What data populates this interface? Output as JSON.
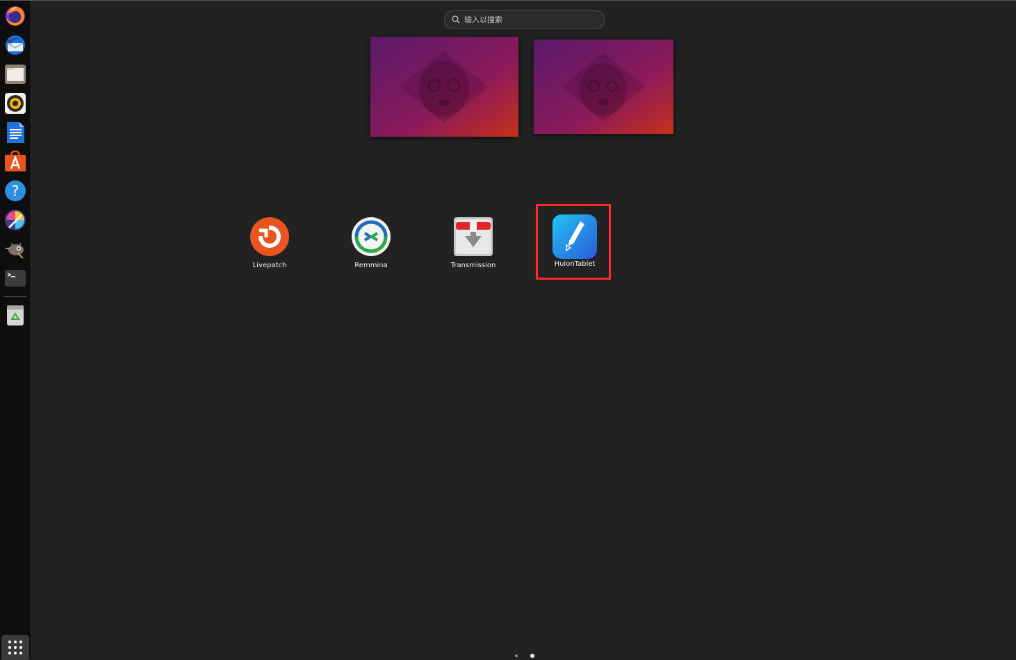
{
  "search": {
    "placeholder": "输入以搜索"
  },
  "dock": {
    "items": [
      {
        "name": "firefox-icon"
      },
      {
        "name": "thunderbird-icon"
      },
      {
        "name": "files-icon"
      },
      {
        "name": "rhythmbox-icon"
      },
      {
        "name": "libreoffice-writer-icon"
      },
      {
        "name": "app-center-icon"
      },
      {
        "name": "help-icon"
      },
      {
        "name": "krita-icon"
      },
      {
        "name": "gimp-icon"
      },
      {
        "name": "terminal-icon"
      },
      {
        "name": "trash-icon"
      }
    ],
    "show_apps": "apps-grid-icon"
  },
  "apps": [
    {
      "label": "Livepatch"
    },
    {
      "label": "Remmina"
    },
    {
      "label": "Transmission"
    },
    {
      "label": "HuionTablet",
      "highlighted": true
    }
  ],
  "pagination": {
    "pages": 2,
    "current": 2
  },
  "colors": {
    "background": "#222222",
    "dock": "#0e0e0e",
    "highlight": "#ff2a2a"
  }
}
